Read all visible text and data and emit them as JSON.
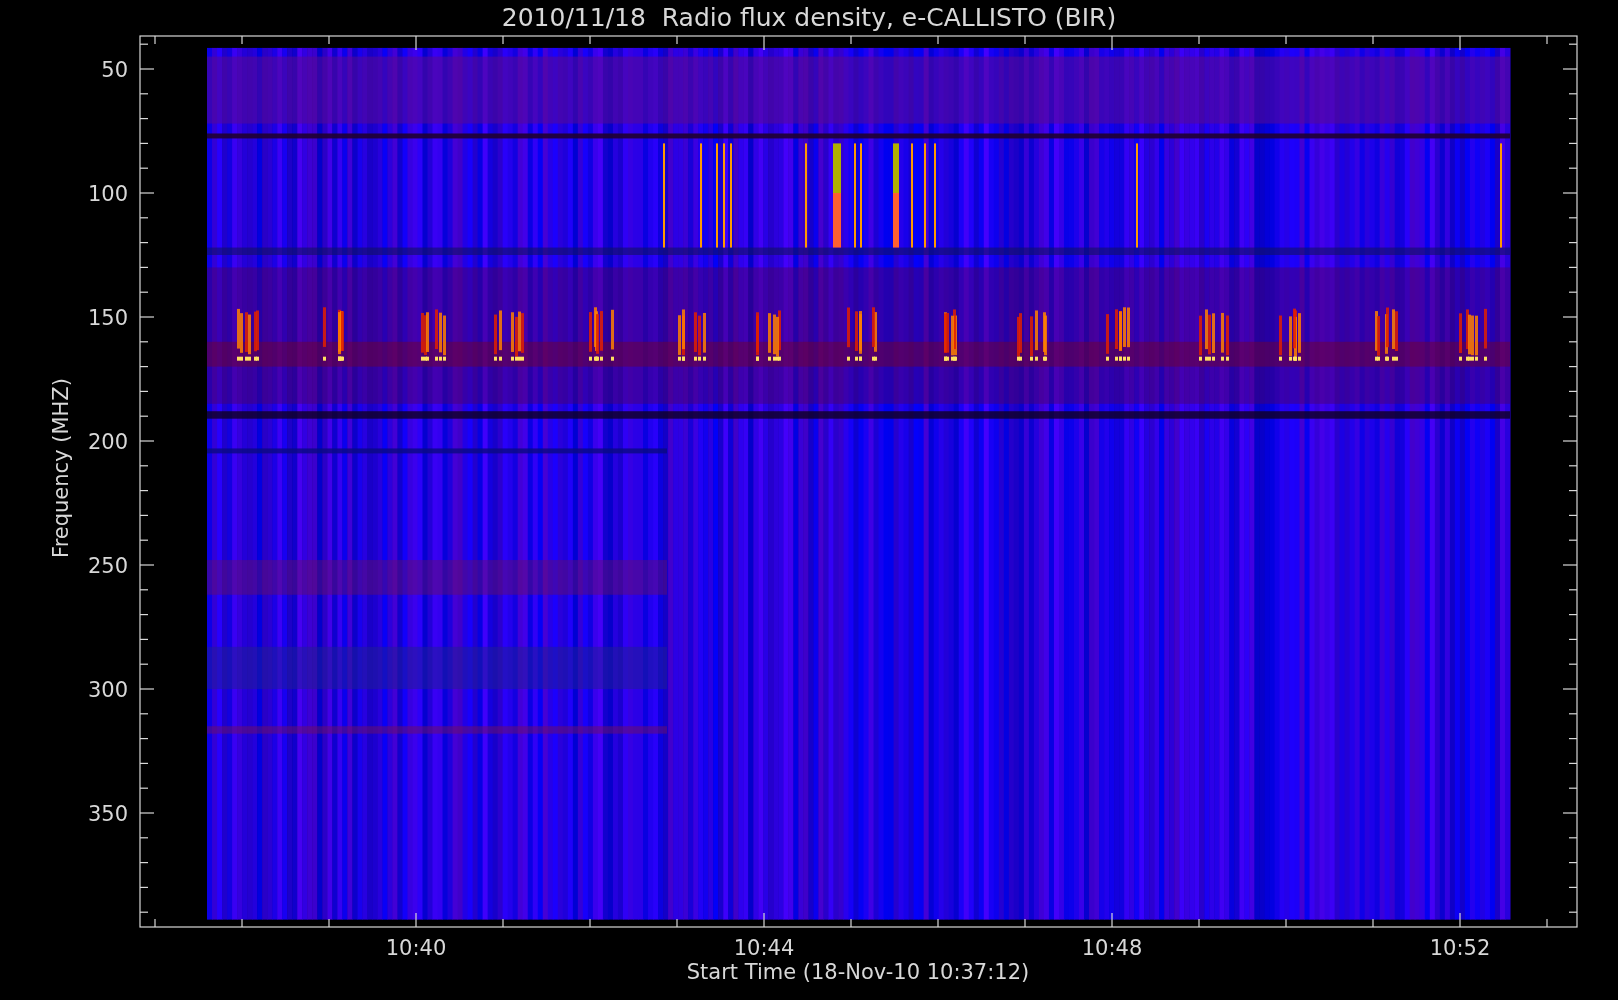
{
  "title": "2010/11/18  Radio flux density, e-CALLISTO (BIR)",
  "y_axis": {
    "label": "Frequency (MHZ)",
    "ticks": [
      "50",
      "100",
      "150",
      "200",
      "250",
      "300",
      "350"
    ]
  },
  "x_axis": {
    "label": "Start Time (18-Nov-10 10:37:12)",
    "ticks": [
      "10:40",
      "10:44",
      "10:48",
      "10:52"
    ]
  }
}
